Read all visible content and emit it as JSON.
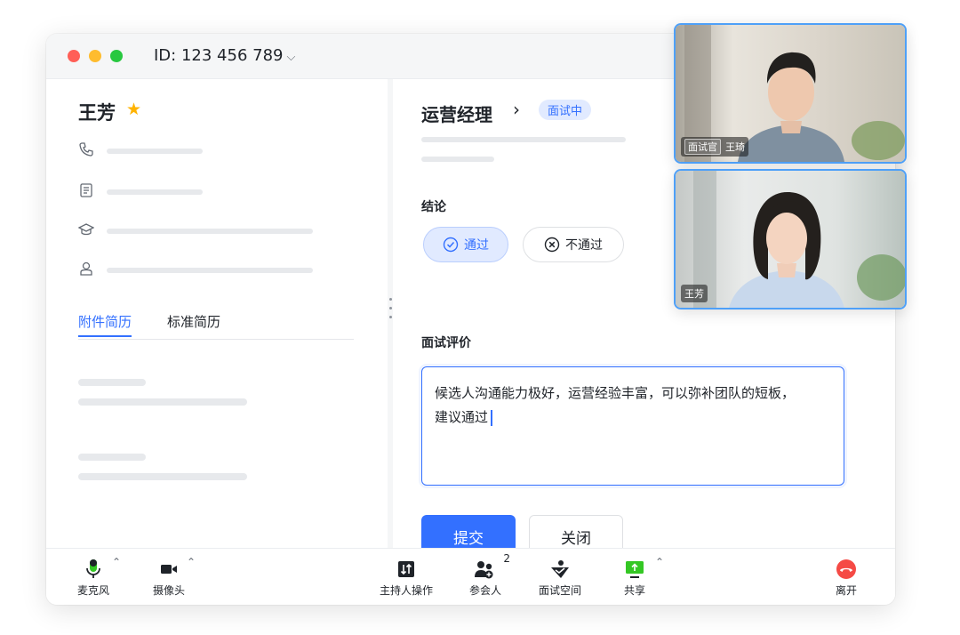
{
  "window": {
    "meeting_id": "ID: 123 456 789"
  },
  "candidate": {
    "name": "王芳"
  },
  "resume_tabs": [
    {
      "label": "附件简历"
    },
    {
      "label": "标准简历"
    }
  ],
  "position": {
    "title": "运营经理",
    "status": "面试中"
  },
  "conclusion": {
    "label": "结论",
    "pass_label": "通过",
    "fail_label": "不通过"
  },
  "evaluation": {
    "label": "面试评价",
    "text_line1": "候选人沟通能力极好，运营经验丰富，可以弥补团队的短板，",
    "text_line2": "建议通过"
  },
  "actions": {
    "submit": "提交",
    "close": "关闭"
  },
  "toolbar": {
    "mic": "麦克风",
    "camera": "摄像头",
    "host_actions": "主持人操作",
    "participants": "参会人",
    "participants_count": "2",
    "interview_space": "面试空间",
    "share": "共享",
    "leave": "离开"
  },
  "videos": [
    {
      "role": "面试官",
      "name": "王琦"
    },
    {
      "name": "王芳"
    }
  ],
  "colors": {
    "accent": "#3370ff",
    "leave": "#f54a45",
    "share": "#34c724"
  }
}
